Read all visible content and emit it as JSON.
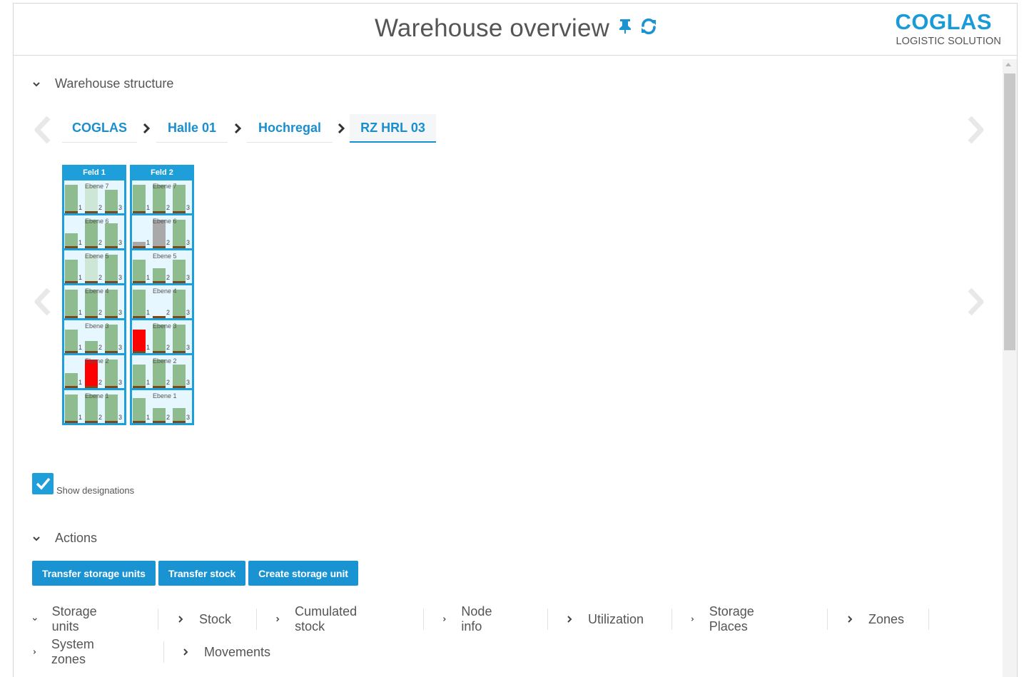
{
  "header": {
    "title": "Warehouse overview",
    "pin_icon": "pin-icon",
    "refresh_icon": "refresh-icon",
    "logo_main": "COGLAS",
    "logo_sub": "LOGISTIC SOLUTION"
  },
  "colors": {
    "accent": "#1e9fd9",
    "occupied": "#8fbc8f",
    "light_occupied": "#cde6d6",
    "blocked": "#ff0000",
    "reserved": "#a9a9a9",
    "base": "#7a4a1a"
  },
  "warehouse_structure": {
    "label": "Warehouse structure",
    "breadcrumbs": [
      "COGLAS",
      "Halle 01",
      "Hochregal",
      "RZ HRL 03"
    ],
    "racks": [
      {
        "name": "Feld 1",
        "levels": [
          {
            "label": "Ebene 7",
            "slots": [
              {
                "num": "1",
                "fill": 0.92,
                "color": "green"
              },
              {
                "num": "2",
                "fill": 0.92,
                "color": "light"
              },
              {
                "num": "3",
                "fill": 0.75,
                "color": "green"
              }
            ]
          },
          {
            "label": "Ebene 6",
            "slots": [
              {
                "num": "1",
                "fill": 0.45,
                "color": "green"
              },
              {
                "num": "2",
                "fill": 0.92,
                "color": "green"
              },
              {
                "num": "3",
                "fill": 0.8,
                "color": "green"
              }
            ]
          },
          {
            "label": "Ebene 5",
            "slots": [
              {
                "num": "1",
                "fill": 0.75,
                "color": "green"
              },
              {
                "num": "2",
                "fill": 0.92,
                "color": "light"
              },
              {
                "num": "3",
                "fill": 0.92,
                "color": "green"
              }
            ]
          },
          {
            "label": "Ebene 4",
            "slots": [
              {
                "num": "1",
                "fill": 0.92,
                "color": "green"
              },
              {
                "num": "2",
                "fill": 0.92,
                "color": "green"
              },
              {
                "num": "3",
                "fill": 0.92,
                "color": "green"
              }
            ]
          },
          {
            "label": "Ebene 3",
            "slots": [
              {
                "num": "1",
                "fill": 0.75,
                "color": "green"
              },
              {
                "num": "2",
                "fill": 0.35,
                "color": "green"
              },
              {
                "num": "3",
                "fill": 0.92,
                "color": "green"
              }
            ]
          },
          {
            "label": "Ebene 2",
            "slots": [
              {
                "num": "1",
                "fill": 0.45,
                "color": "green"
              },
              {
                "num": "2",
                "fill": 0.92,
                "color": "red"
              },
              {
                "num": "3",
                "fill": 0.92,
                "color": "green"
              }
            ]
          },
          {
            "label": "Ebene 1",
            "slots": [
              {
                "num": "1",
                "fill": 0.92,
                "color": "green"
              },
              {
                "num": "2",
                "fill": 0.92,
                "color": "green"
              },
              {
                "num": "3",
                "fill": 0.92,
                "color": "green"
              }
            ]
          }
        ]
      },
      {
        "name": "Feld 2",
        "levels": [
          {
            "label": "Ebene 7",
            "slots": [
              {
                "num": "1",
                "fill": 0.92,
                "color": "green"
              },
              {
                "num": "2",
                "fill": 0.92,
                "color": "green"
              },
              {
                "num": "3",
                "fill": 0.92,
                "color": "green"
              }
            ]
          },
          {
            "label": "Ebene 6",
            "slots": [
              {
                "num": "1",
                "fill": 0.15,
                "color": "gray"
              },
              {
                "num": "2",
                "fill": 0.92,
                "color": "gray"
              },
              {
                "num": "3",
                "fill": 0.92,
                "color": "green"
              }
            ]
          },
          {
            "label": "Ebene 5",
            "slots": [
              {
                "num": "1",
                "fill": 0.75,
                "color": "green"
              },
              {
                "num": "2",
                "fill": 0.45,
                "color": "green"
              },
              {
                "num": "3",
                "fill": 0.75,
                "color": "green"
              }
            ]
          },
          {
            "label": "Ebene 4",
            "slots": [
              {
                "num": "1",
                "fill": 0.92,
                "color": "green"
              },
              {
                "num": "2",
                "fill": 0.0,
                "color": "green"
              },
              {
                "num": "3",
                "fill": 0.92,
                "color": "green"
              }
            ]
          },
          {
            "label": "Ebene 3",
            "slots": [
              {
                "num": "1",
                "fill": 0.75,
                "color": "red"
              },
              {
                "num": "2",
                "fill": 0.92,
                "color": "green"
              },
              {
                "num": "3",
                "fill": 0.92,
                "color": "green"
              }
            ]
          },
          {
            "label": "Ebene 2",
            "slots": [
              {
                "num": "1",
                "fill": 0.75,
                "color": "green"
              },
              {
                "num": "2",
                "fill": 0.92,
                "color": "green"
              },
              {
                "num": "3",
                "fill": 0.75,
                "color": "green"
              }
            ]
          },
          {
            "label": "Ebene 1",
            "slots": [
              {
                "num": "1",
                "fill": 0.8,
                "color": "green"
              },
              {
                "num": "2",
                "fill": 0.45,
                "color": "green"
              },
              {
                "num": "3",
                "fill": 0.45,
                "color": "green"
              }
            ]
          }
        ]
      }
    ],
    "show_designations": {
      "label": "Show designations",
      "checked": true
    }
  },
  "actions": {
    "label": "Actions",
    "buttons": [
      "Transfer storage units",
      "Transfer stock",
      "Create storage unit"
    ]
  },
  "tabs_row1": [
    "Storage units",
    "Stock",
    "Cumulated stock",
    "Node info",
    "Utilization",
    "Storage Places",
    "Zones"
  ],
  "tabs_row2": [
    "System zones",
    "Movements"
  ]
}
